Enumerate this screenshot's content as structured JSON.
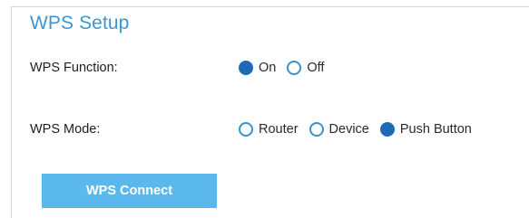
{
  "section": {
    "title": "WPS Setup"
  },
  "wps_function": {
    "label": "WPS Function:",
    "options": [
      {
        "label": "On",
        "selected": true
      },
      {
        "label": "Off",
        "selected": false
      }
    ]
  },
  "wps_mode": {
    "label": "WPS Mode:",
    "options": [
      {
        "label": "Router",
        "selected": false
      },
      {
        "label": "Device",
        "selected": false
      },
      {
        "label": "Push Button",
        "selected": true
      }
    ]
  },
  "actions": {
    "connect_label": "WPS Connect"
  },
  "colors": {
    "accent": "#3b95d4",
    "radio_selected": "#1f68b8",
    "button_bg": "#5bb8ec"
  }
}
